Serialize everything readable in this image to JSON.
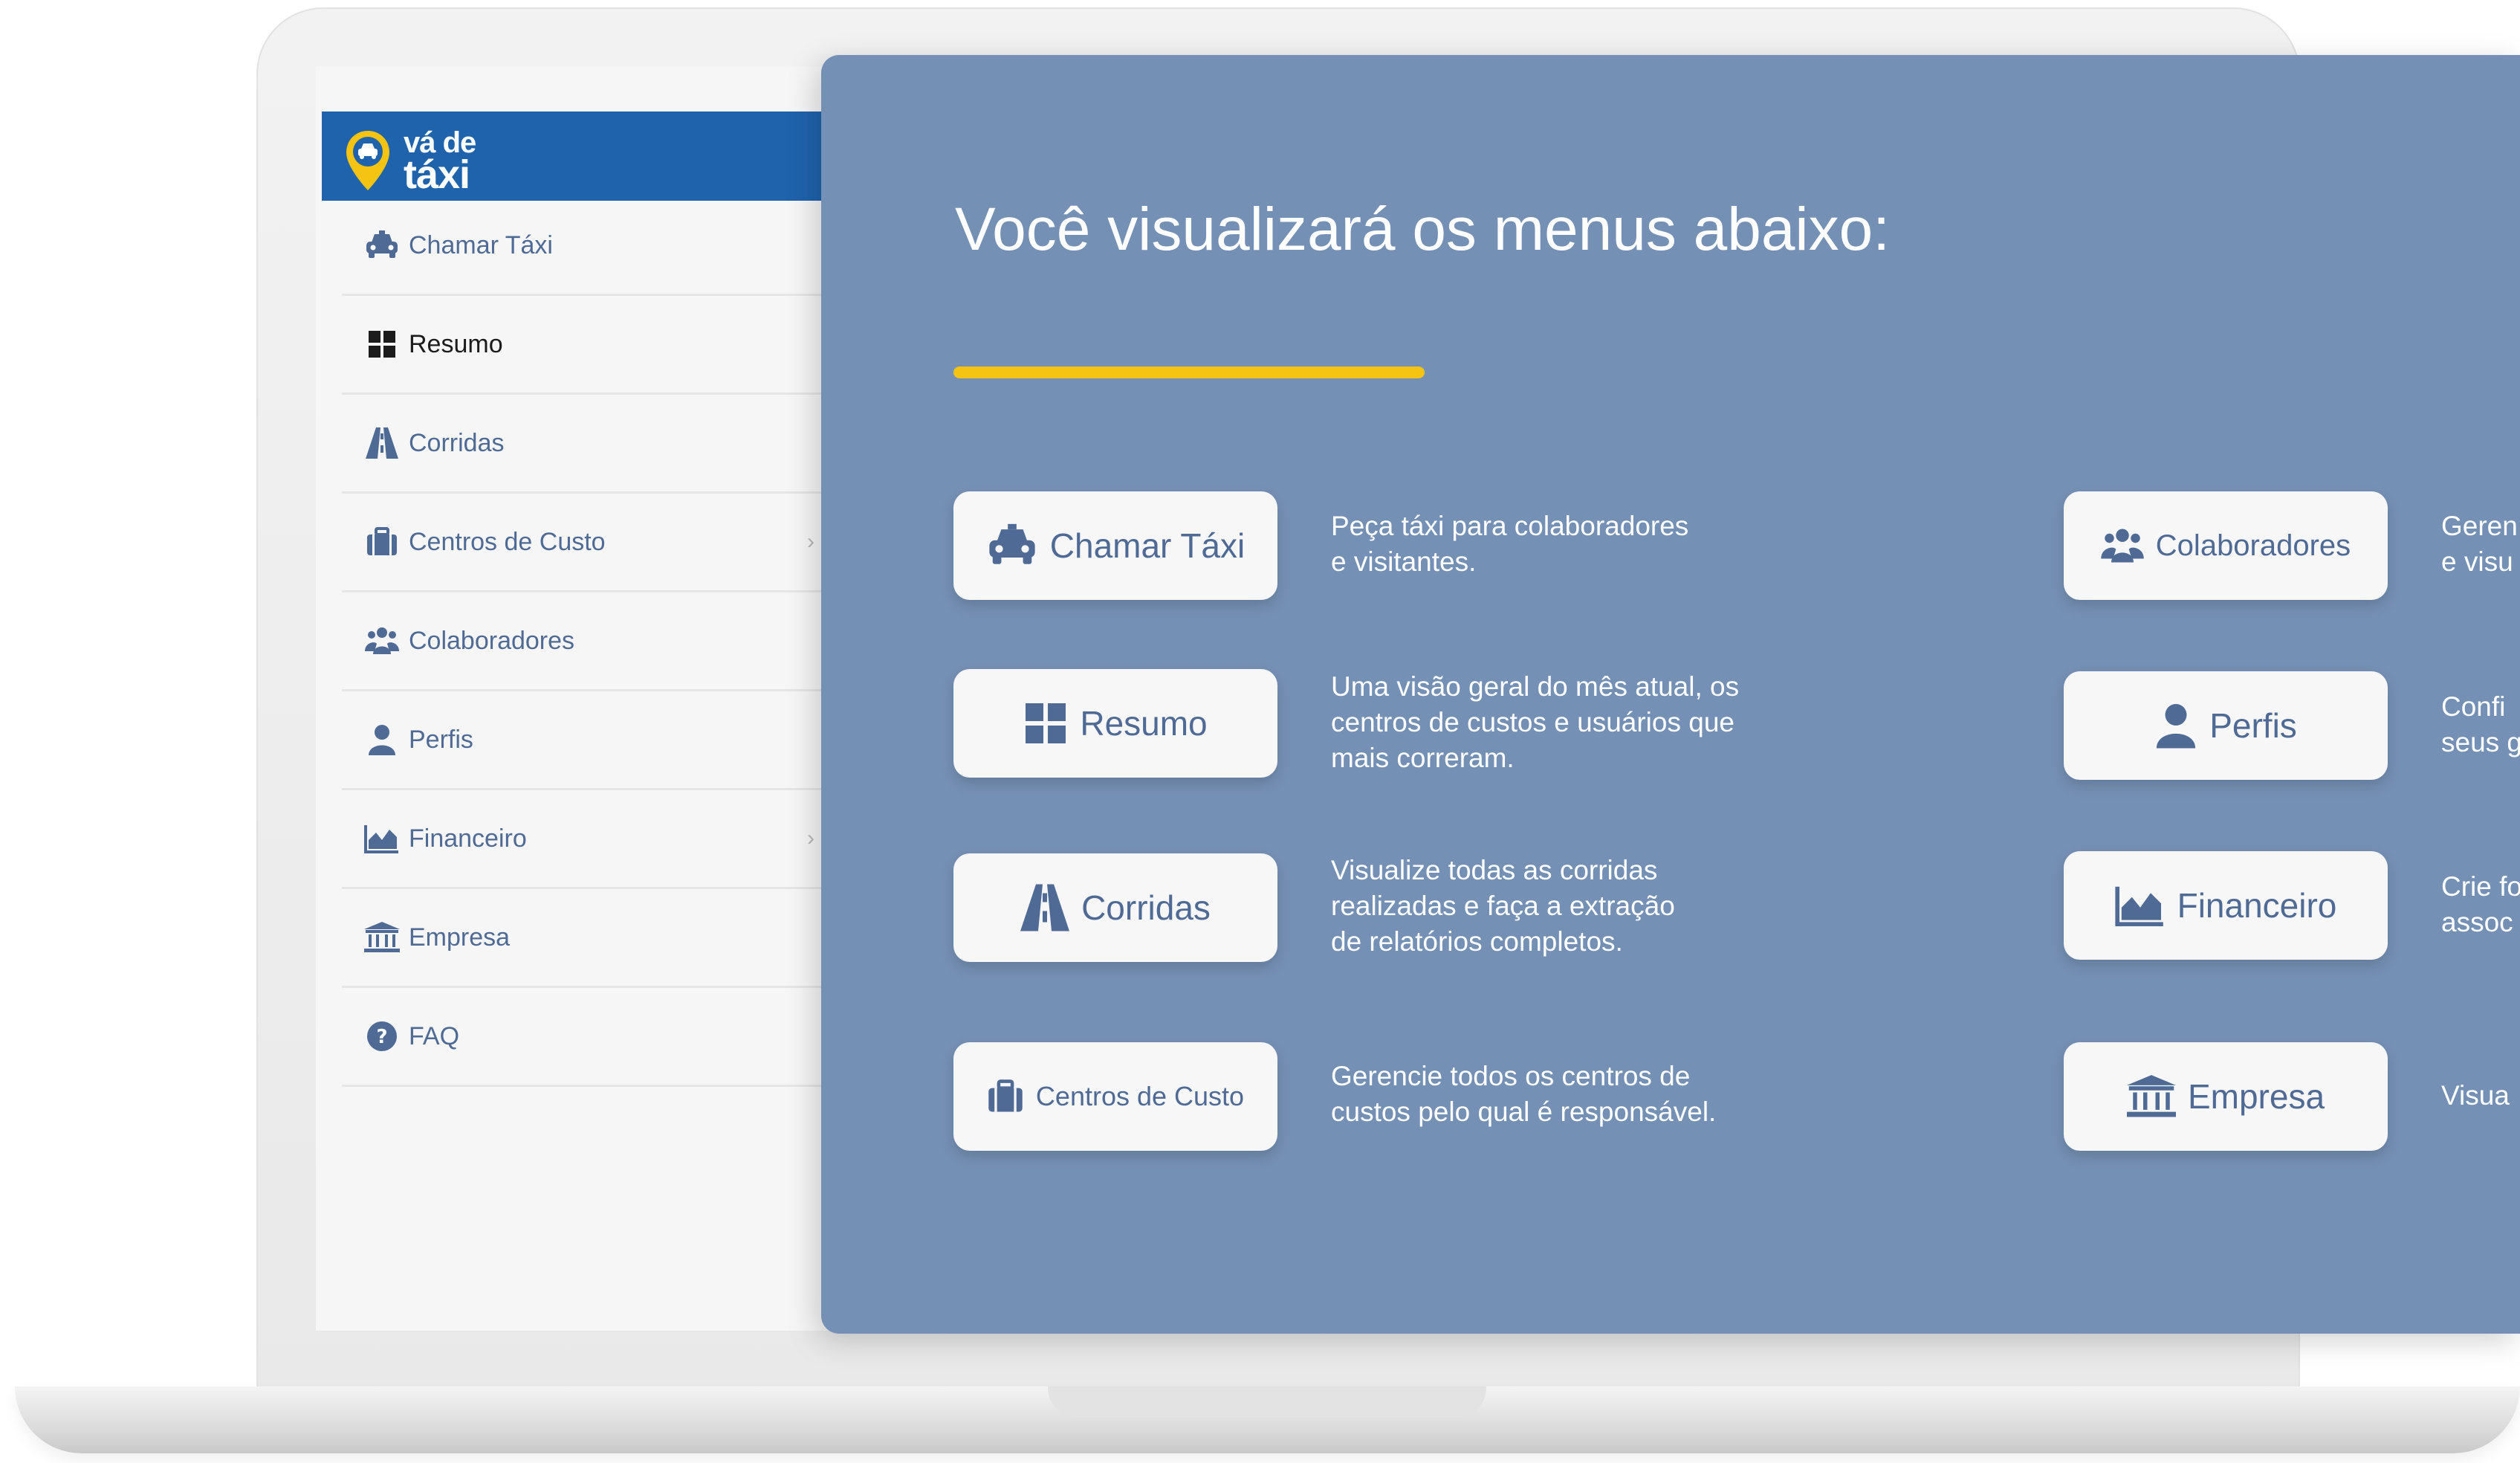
{
  "brand": {
    "logo_line1": "vá de",
    "logo_line2": "táxi",
    "header_color": "#1f63ad",
    "logo_pin_color": "#f5c311"
  },
  "sidebar": {
    "items": [
      {
        "label": "Chamar Táxi",
        "icon": "taxi-icon",
        "active": false,
        "chevron": false
      },
      {
        "label": "Resumo",
        "icon": "grid-icon",
        "active": true,
        "chevron": false
      },
      {
        "label": "Corridas",
        "icon": "road-icon",
        "active": false,
        "chevron": false
      },
      {
        "label": "Centros de Custo",
        "icon": "briefcase-icon",
        "active": false,
        "chevron": true
      },
      {
        "label": "Colaboradores",
        "icon": "users-icon",
        "active": false,
        "chevron": false
      },
      {
        "label": "Perfis",
        "icon": "user-icon",
        "active": false,
        "chevron": false
      },
      {
        "label": "Financeiro",
        "icon": "chart-area-icon",
        "active": false,
        "chevron": true
      },
      {
        "label": "Empresa",
        "icon": "bank-icon",
        "active": false,
        "chevron": false
      },
      {
        "label": "FAQ",
        "icon": "question-icon",
        "active": false,
        "chevron": false
      }
    ]
  },
  "panel": {
    "title": "Você visualizará os menus abaixo:",
    "background": "#7590b5",
    "accent": "#f5c311",
    "left_cards": [
      {
        "label": "Chamar Táxi",
        "icon": "taxi-icon",
        "description": [
          "Peça táxi para colaboradores",
          "e visitantes."
        ]
      },
      {
        "label": "Resumo",
        "icon": "grid-icon",
        "description": [
          "Uma visão geral do mês atual, os",
          "centros de custos e usuários que",
          "mais correram."
        ]
      },
      {
        "label": "Corridas",
        "icon": "road-icon",
        "description": [
          "Visualize todas as corridas",
          "realizadas e faça a extração",
          "de relatórios completos."
        ]
      },
      {
        "label": "Centros de Custo",
        "icon": "briefcase-icon",
        "description": [
          "Gerencie todos os centros de",
          "custos pelo qual é responsável."
        ]
      }
    ],
    "right_cards": [
      {
        "label": "Colaboradores",
        "icon": "users-icon",
        "description": [
          "Geren",
          "e visu"
        ]
      },
      {
        "label": "Perfis",
        "icon": "user-icon",
        "description": [
          "Confi",
          "seus g"
        ]
      },
      {
        "label": "Financeiro",
        "icon": "chart-area-icon",
        "description": [
          "Crie fo",
          "assoc"
        ]
      },
      {
        "label": "Empresa",
        "icon": "bank-icon",
        "description": [
          "Visua"
        ]
      }
    ]
  }
}
